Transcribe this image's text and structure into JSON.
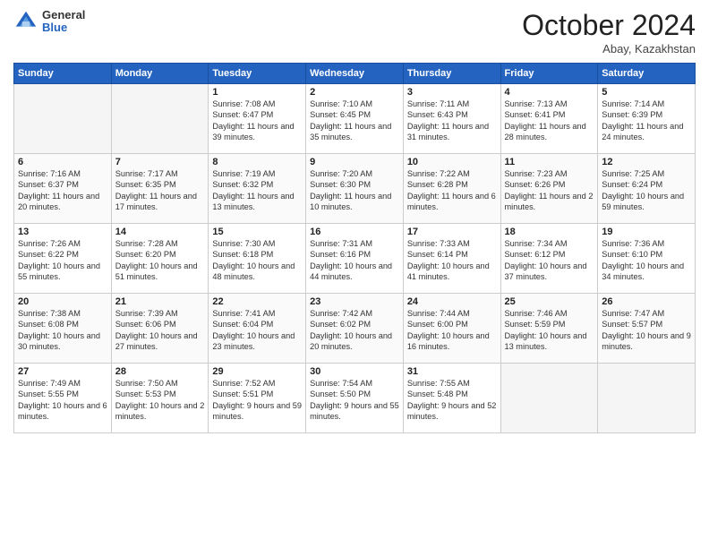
{
  "header": {
    "logo_general": "General",
    "logo_blue": "Blue",
    "month_title": "October 2024",
    "location": "Abay, Kazakhstan"
  },
  "days_of_week": [
    "Sunday",
    "Monday",
    "Tuesday",
    "Wednesday",
    "Thursday",
    "Friday",
    "Saturday"
  ],
  "weeks": [
    [
      {
        "day": "",
        "sunrise": "",
        "sunset": "",
        "daylight": "",
        "empty": true
      },
      {
        "day": "",
        "sunrise": "",
        "sunset": "",
        "daylight": "",
        "empty": true
      },
      {
        "day": "1",
        "sunrise": "Sunrise: 7:08 AM",
        "sunset": "Sunset: 6:47 PM",
        "daylight": "Daylight: 11 hours and 39 minutes.",
        "empty": false
      },
      {
        "day": "2",
        "sunrise": "Sunrise: 7:10 AM",
        "sunset": "Sunset: 6:45 PM",
        "daylight": "Daylight: 11 hours and 35 minutes.",
        "empty": false
      },
      {
        "day": "3",
        "sunrise": "Sunrise: 7:11 AM",
        "sunset": "Sunset: 6:43 PM",
        "daylight": "Daylight: 11 hours and 31 minutes.",
        "empty": false
      },
      {
        "day": "4",
        "sunrise": "Sunrise: 7:13 AM",
        "sunset": "Sunset: 6:41 PM",
        "daylight": "Daylight: 11 hours and 28 minutes.",
        "empty": false
      },
      {
        "day": "5",
        "sunrise": "Sunrise: 7:14 AM",
        "sunset": "Sunset: 6:39 PM",
        "daylight": "Daylight: 11 hours and 24 minutes.",
        "empty": false
      }
    ],
    [
      {
        "day": "6",
        "sunrise": "Sunrise: 7:16 AM",
        "sunset": "Sunset: 6:37 PM",
        "daylight": "Daylight: 11 hours and 20 minutes.",
        "empty": false
      },
      {
        "day": "7",
        "sunrise": "Sunrise: 7:17 AM",
        "sunset": "Sunset: 6:35 PM",
        "daylight": "Daylight: 11 hours and 17 minutes.",
        "empty": false
      },
      {
        "day": "8",
        "sunrise": "Sunrise: 7:19 AM",
        "sunset": "Sunset: 6:32 PM",
        "daylight": "Daylight: 11 hours and 13 minutes.",
        "empty": false
      },
      {
        "day": "9",
        "sunrise": "Sunrise: 7:20 AM",
        "sunset": "Sunset: 6:30 PM",
        "daylight": "Daylight: 11 hours and 10 minutes.",
        "empty": false
      },
      {
        "day": "10",
        "sunrise": "Sunrise: 7:22 AM",
        "sunset": "Sunset: 6:28 PM",
        "daylight": "Daylight: 11 hours and 6 minutes.",
        "empty": false
      },
      {
        "day": "11",
        "sunrise": "Sunrise: 7:23 AM",
        "sunset": "Sunset: 6:26 PM",
        "daylight": "Daylight: 11 hours and 2 minutes.",
        "empty": false
      },
      {
        "day": "12",
        "sunrise": "Sunrise: 7:25 AM",
        "sunset": "Sunset: 6:24 PM",
        "daylight": "Daylight: 10 hours and 59 minutes.",
        "empty": false
      }
    ],
    [
      {
        "day": "13",
        "sunrise": "Sunrise: 7:26 AM",
        "sunset": "Sunset: 6:22 PM",
        "daylight": "Daylight: 10 hours and 55 minutes.",
        "empty": false
      },
      {
        "day": "14",
        "sunrise": "Sunrise: 7:28 AM",
        "sunset": "Sunset: 6:20 PM",
        "daylight": "Daylight: 10 hours and 51 minutes.",
        "empty": false
      },
      {
        "day": "15",
        "sunrise": "Sunrise: 7:30 AM",
        "sunset": "Sunset: 6:18 PM",
        "daylight": "Daylight: 10 hours and 48 minutes.",
        "empty": false
      },
      {
        "day": "16",
        "sunrise": "Sunrise: 7:31 AM",
        "sunset": "Sunset: 6:16 PM",
        "daylight": "Daylight: 10 hours and 44 minutes.",
        "empty": false
      },
      {
        "day": "17",
        "sunrise": "Sunrise: 7:33 AM",
        "sunset": "Sunset: 6:14 PM",
        "daylight": "Daylight: 10 hours and 41 minutes.",
        "empty": false
      },
      {
        "day": "18",
        "sunrise": "Sunrise: 7:34 AM",
        "sunset": "Sunset: 6:12 PM",
        "daylight": "Daylight: 10 hours and 37 minutes.",
        "empty": false
      },
      {
        "day": "19",
        "sunrise": "Sunrise: 7:36 AM",
        "sunset": "Sunset: 6:10 PM",
        "daylight": "Daylight: 10 hours and 34 minutes.",
        "empty": false
      }
    ],
    [
      {
        "day": "20",
        "sunrise": "Sunrise: 7:38 AM",
        "sunset": "Sunset: 6:08 PM",
        "daylight": "Daylight: 10 hours and 30 minutes.",
        "empty": false
      },
      {
        "day": "21",
        "sunrise": "Sunrise: 7:39 AM",
        "sunset": "Sunset: 6:06 PM",
        "daylight": "Daylight: 10 hours and 27 minutes.",
        "empty": false
      },
      {
        "day": "22",
        "sunrise": "Sunrise: 7:41 AM",
        "sunset": "Sunset: 6:04 PM",
        "daylight": "Daylight: 10 hours and 23 minutes.",
        "empty": false
      },
      {
        "day": "23",
        "sunrise": "Sunrise: 7:42 AM",
        "sunset": "Sunset: 6:02 PM",
        "daylight": "Daylight: 10 hours and 20 minutes.",
        "empty": false
      },
      {
        "day": "24",
        "sunrise": "Sunrise: 7:44 AM",
        "sunset": "Sunset: 6:00 PM",
        "daylight": "Daylight: 10 hours and 16 minutes.",
        "empty": false
      },
      {
        "day": "25",
        "sunrise": "Sunrise: 7:46 AM",
        "sunset": "Sunset: 5:59 PM",
        "daylight": "Daylight: 10 hours and 13 minutes.",
        "empty": false
      },
      {
        "day": "26",
        "sunrise": "Sunrise: 7:47 AM",
        "sunset": "Sunset: 5:57 PM",
        "daylight": "Daylight: 10 hours and 9 minutes.",
        "empty": false
      }
    ],
    [
      {
        "day": "27",
        "sunrise": "Sunrise: 7:49 AM",
        "sunset": "Sunset: 5:55 PM",
        "daylight": "Daylight: 10 hours and 6 minutes.",
        "empty": false
      },
      {
        "day": "28",
        "sunrise": "Sunrise: 7:50 AM",
        "sunset": "Sunset: 5:53 PM",
        "daylight": "Daylight: 10 hours and 2 minutes.",
        "empty": false
      },
      {
        "day": "29",
        "sunrise": "Sunrise: 7:52 AM",
        "sunset": "Sunset: 5:51 PM",
        "daylight": "Daylight: 9 hours and 59 minutes.",
        "empty": false
      },
      {
        "day": "30",
        "sunrise": "Sunrise: 7:54 AM",
        "sunset": "Sunset: 5:50 PM",
        "daylight": "Daylight: 9 hours and 55 minutes.",
        "empty": false
      },
      {
        "day": "31",
        "sunrise": "Sunrise: 7:55 AM",
        "sunset": "Sunset: 5:48 PM",
        "daylight": "Daylight: 9 hours and 52 minutes.",
        "empty": false
      },
      {
        "day": "",
        "sunrise": "",
        "sunset": "",
        "daylight": "",
        "empty": true
      },
      {
        "day": "",
        "sunrise": "",
        "sunset": "",
        "daylight": "",
        "empty": true
      }
    ]
  ]
}
